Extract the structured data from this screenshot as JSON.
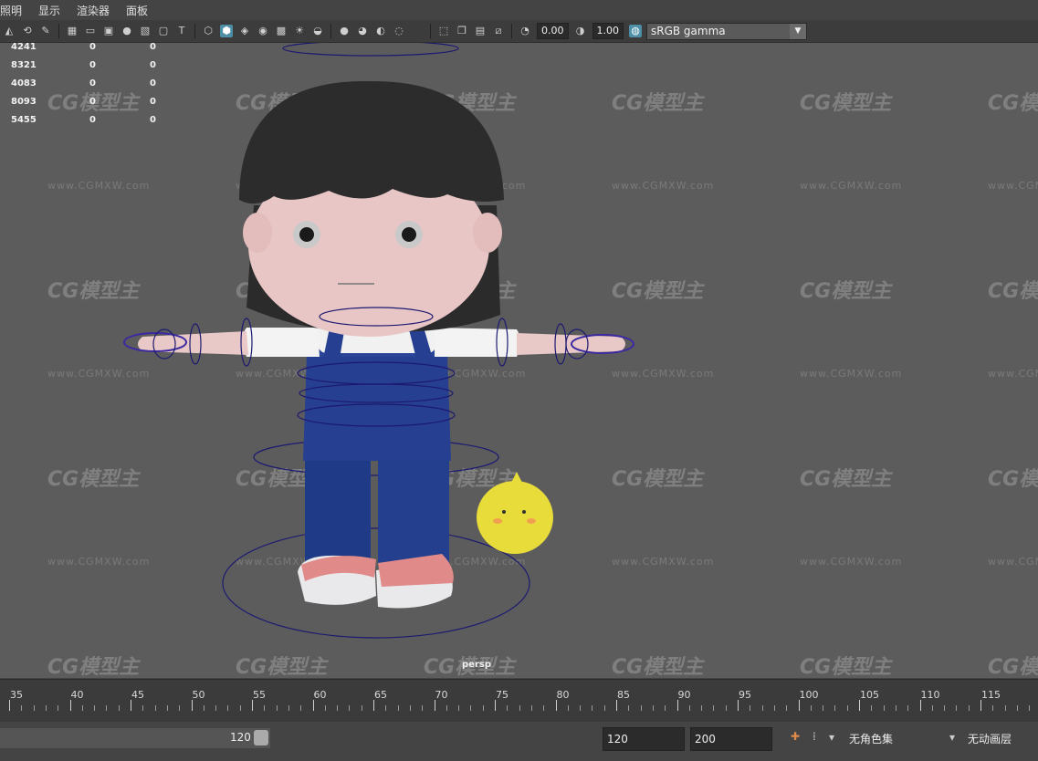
{
  "menu": [
    "照明",
    "显示",
    "渲染器",
    "面板"
  ],
  "toolbar": {
    "exposure": "0.00",
    "gamma": "1.00",
    "color_management": "sRGB gamma"
  },
  "hud": [
    {
      "a": "4241",
      "b": "0",
      "c": "0"
    },
    {
      "a": "8321",
      "b": "0",
      "c": "0"
    },
    {
      "a": "4083",
      "b": "0",
      "c": "0"
    },
    {
      "a": "8093",
      "b": "0",
      "c": "0"
    },
    {
      "a": "5455",
      "b": "0",
      "c": "0"
    }
  ],
  "watermark": "CG模型主",
  "watermark_url": "www.CGMXW.com",
  "camera": "persp",
  "timeline": {
    "labels": [
      "35",
      "40",
      "45",
      "50",
      "55",
      "60",
      "65",
      "70",
      "75",
      "80",
      "85",
      "90",
      "95",
      "100",
      "105",
      "110",
      "115"
    ]
  },
  "range": {
    "slider_end": "120",
    "playback_end": "120",
    "anim_end": "200",
    "character_set": "无角色集",
    "anim_layer": "无动画层"
  },
  "colors": {
    "viewport_bg": "#5c5c5c",
    "accent": "#4e8fa8"
  }
}
